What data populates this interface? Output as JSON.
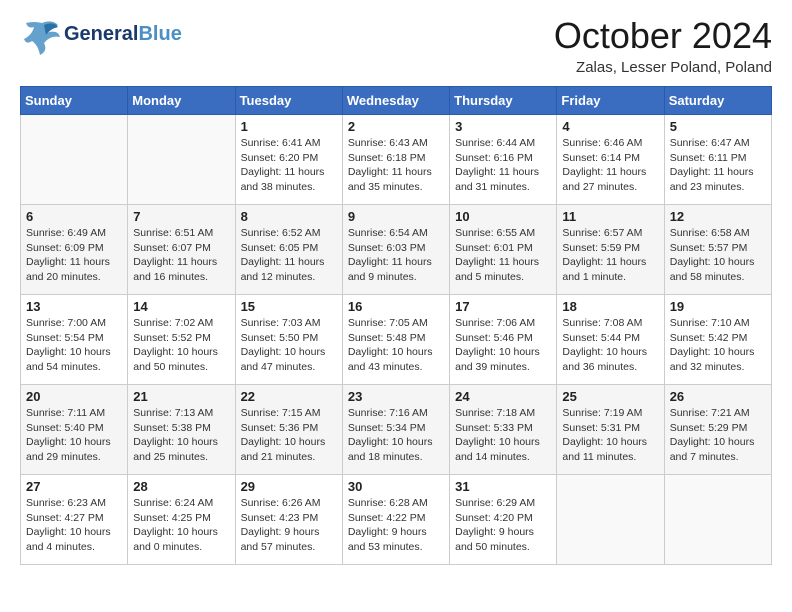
{
  "header": {
    "logo_general": "General",
    "logo_blue": "Blue",
    "month": "October 2024",
    "location": "Zalas, Lesser Poland, Poland"
  },
  "weekdays": [
    "Sunday",
    "Monday",
    "Tuesday",
    "Wednesday",
    "Thursday",
    "Friday",
    "Saturday"
  ],
  "weeks": [
    [
      {
        "day": "",
        "info": ""
      },
      {
        "day": "",
        "info": ""
      },
      {
        "day": "1",
        "info": "Sunrise: 6:41 AM\nSunset: 6:20 PM\nDaylight: 11 hours\nand 38 minutes."
      },
      {
        "day": "2",
        "info": "Sunrise: 6:43 AM\nSunset: 6:18 PM\nDaylight: 11 hours\nand 35 minutes."
      },
      {
        "day": "3",
        "info": "Sunrise: 6:44 AM\nSunset: 6:16 PM\nDaylight: 11 hours\nand 31 minutes."
      },
      {
        "day": "4",
        "info": "Sunrise: 6:46 AM\nSunset: 6:14 PM\nDaylight: 11 hours\nand 27 minutes."
      },
      {
        "day": "5",
        "info": "Sunrise: 6:47 AM\nSunset: 6:11 PM\nDaylight: 11 hours\nand 23 minutes."
      }
    ],
    [
      {
        "day": "6",
        "info": "Sunrise: 6:49 AM\nSunset: 6:09 PM\nDaylight: 11 hours\nand 20 minutes."
      },
      {
        "day": "7",
        "info": "Sunrise: 6:51 AM\nSunset: 6:07 PM\nDaylight: 11 hours\nand 16 minutes."
      },
      {
        "day": "8",
        "info": "Sunrise: 6:52 AM\nSunset: 6:05 PM\nDaylight: 11 hours\nand 12 minutes."
      },
      {
        "day": "9",
        "info": "Sunrise: 6:54 AM\nSunset: 6:03 PM\nDaylight: 11 hours\nand 9 minutes."
      },
      {
        "day": "10",
        "info": "Sunrise: 6:55 AM\nSunset: 6:01 PM\nDaylight: 11 hours\nand 5 minutes."
      },
      {
        "day": "11",
        "info": "Sunrise: 6:57 AM\nSunset: 5:59 PM\nDaylight: 11 hours\nand 1 minute."
      },
      {
        "day": "12",
        "info": "Sunrise: 6:58 AM\nSunset: 5:57 PM\nDaylight: 10 hours\nand 58 minutes."
      }
    ],
    [
      {
        "day": "13",
        "info": "Sunrise: 7:00 AM\nSunset: 5:54 PM\nDaylight: 10 hours\nand 54 minutes."
      },
      {
        "day": "14",
        "info": "Sunrise: 7:02 AM\nSunset: 5:52 PM\nDaylight: 10 hours\nand 50 minutes."
      },
      {
        "day": "15",
        "info": "Sunrise: 7:03 AM\nSunset: 5:50 PM\nDaylight: 10 hours\nand 47 minutes."
      },
      {
        "day": "16",
        "info": "Sunrise: 7:05 AM\nSunset: 5:48 PM\nDaylight: 10 hours\nand 43 minutes."
      },
      {
        "day": "17",
        "info": "Sunrise: 7:06 AM\nSunset: 5:46 PM\nDaylight: 10 hours\nand 39 minutes."
      },
      {
        "day": "18",
        "info": "Sunrise: 7:08 AM\nSunset: 5:44 PM\nDaylight: 10 hours\nand 36 minutes."
      },
      {
        "day": "19",
        "info": "Sunrise: 7:10 AM\nSunset: 5:42 PM\nDaylight: 10 hours\nand 32 minutes."
      }
    ],
    [
      {
        "day": "20",
        "info": "Sunrise: 7:11 AM\nSunset: 5:40 PM\nDaylight: 10 hours\nand 29 minutes."
      },
      {
        "day": "21",
        "info": "Sunrise: 7:13 AM\nSunset: 5:38 PM\nDaylight: 10 hours\nand 25 minutes."
      },
      {
        "day": "22",
        "info": "Sunrise: 7:15 AM\nSunset: 5:36 PM\nDaylight: 10 hours\nand 21 minutes."
      },
      {
        "day": "23",
        "info": "Sunrise: 7:16 AM\nSunset: 5:34 PM\nDaylight: 10 hours\nand 18 minutes."
      },
      {
        "day": "24",
        "info": "Sunrise: 7:18 AM\nSunset: 5:33 PM\nDaylight: 10 hours\nand 14 minutes."
      },
      {
        "day": "25",
        "info": "Sunrise: 7:19 AM\nSunset: 5:31 PM\nDaylight: 10 hours\nand 11 minutes."
      },
      {
        "day": "26",
        "info": "Sunrise: 7:21 AM\nSunset: 5:29 PM\nDaylight: 10 hours\nand 7 minutes."
      }
    ],
    [
      {
        "day": "27",
        "info": "Sunrise: 6:23 AM\nSunset: 4:27 PM\nDaylight: 10 hours\nand 4 minutes."
      },
      {
        "day": "28",
        "info": "Sunrise: 6:24 AM\nSunset: 4:25 PM\nDaylight: 10 hours\nand 0 minutes."
      },
      {
        "day": "29",
        "info": "Sunrise: 6:26 AM\nSunset: 4:23 PM\nDaylight: 9 hours\nand 57 minutes."
      },
      {
        "day": "30",
        "info": "Sunrise: 6:28 AM\nSunset: 4:22 PM\nDaylight: 9 hours\nand 53 minutes."
      },
      {
        "day": "31",
        "info": "Sunrise: 6:29 AM\nSunset: 4:20 PM\nDaylight: 9 hours\nand 50 minutes."
      },
      {
        "day": "",
        "info": ""
      },
      {
        "day": "",
        "info": ""
      }
    ]
  ]
}
